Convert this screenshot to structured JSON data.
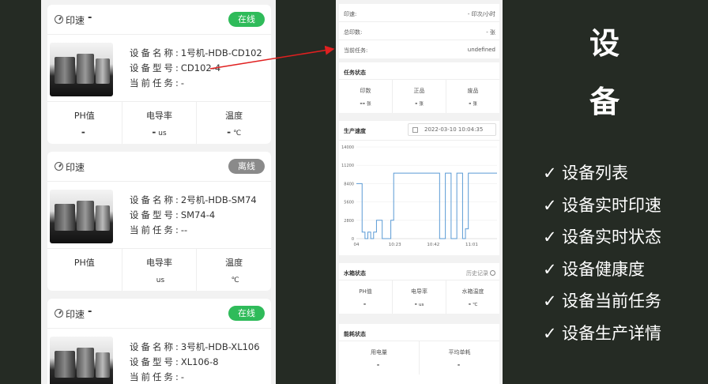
{
  "devices": [
    {
      "speed_label": "印速",
      "speed_value": "-",
      "status": "在线",
      "status_kind": "on",
      "name_key": "设备名称:",
      "name": "1号机-HDB-CD102",
      "model_key": "设备型号:",
      "model": "CD102-4",
      "task_key": "当前任务:",
      "task": "-",
      "metrics": [
        {
          "label": "PH值",
          "value": "-",
          "unit": ""
        },
        {
          "label": "电导率",
          "value": "-",
          "unit": "us"
        },
        {
          "label": "温度",
          "value": "-",
          "unit": "℃"
        }
      ]
    },
    {
      "speed_label": "印速",
      "speed_value": "",
      "status": "离线",
      "status_kind": "off",
      "name_key": "设备名称:",
      "name": "2号机-HDB-SM74",
      "model_key": "设备型号:",
      "model": "SM74-4",
      "task_key": "当前任务:",
      "task": "--",
      "metrics": [
        {
          "label": "PH值",
          "value": "",
          "unit": ""
        },
        {
          "label": "电导率",
          "value": "",
          "unit": "us"
        },
        {
          "label": "温度",
          "value": "",
          "unit": "℃"
        }
      ]
    },
    {
      "speed_label": "印速",
      "speed_value": "-",
      "status": "在线",
      "status_kind": "on",
      "name_key": "设备名称:",
      "name": "3号机-HDB-XL106",
      "model_key": "设备型号:",
      "model": "XL106-8",
      "task_key": "当前任务:",
      "task": "-"
    }
  ],
  "detail": {
    "rows": [
      {
        "label": "印速:",
        "value": "- 印次/小时"
      },
      {
        "label": "总印数:",
        "value": "- 张"
      },
      {
        "label": "当前任务:",
        "value": "undefined"
      }
    ],
    "task_status": {
      "title": "任务状态",
      "cols": [
        {
          "label": "印数",
          "value": "--",
          "unit": "张"
        },
        {
          "label": "正品",
          "value": "-",
          "unit": "张"
        },
        {
          "label": "废品",
          "value": "-",
          "unit": "张"
        }
      ]
    },
    "production": {
      "title": "生产速度",
      "date": "2022-03-10 10:04:35"
    },
    "water_tank": {
      "title": "水箱状态",
      "history": "历史记录",
      "cols": [
        {
          "label": "PH值",
          "value": "-",
          "unit": ""
        },
        {
          "label": "电导率",
          "value": "-",
          "unit": "us"
        },
        {
          "label": "水箱温度",
          "value": "-",
          "unit": "℃"
        }
      ]
    },
    "energy": {
      "title": "能耗状态",
      "cols": [
        {
          "label": "用电量",
          "value": "-",
          "unit": ""
        },
        {
          "label": "平均单耗",
          "value": "-",
          "unit": ""
        }
      ]
    }
  },
  "chart_data": {
    "type": "line",
    "title": "",
    "xlabel": "",
    "ylabel": "",
    "ylim": [
      0,
      14000
    ],
    "yticks": [
      0,
      2800,
      5600,
      8400,
      11200,
      14000
    ],
    "xticks": [
      "04",
      "10:23",
      "10:42",
      "11:01"
    ],
    "x": [
      0,
      1,
      2,
      3,
      4,
      5,
      6,
      7,
      8,
      9,
      10,
      11,
      12,
      13,
      14,
      15,
      16,
      17,
      18,
      19,
      20,
      21,
      22,
      23,
      24,
      25,
      26,
      27,
      28,
      29,
      30,
      31,
      32,
      33,
      34,
      35,
      36,
      37,
      38,
      39,
      40,
      41,
      42,
      43,
      44,
      45,
      46,
      47,
      48,
      49
    ],
    "values": [
      8400,
      8400,
      1000,
      0,
      1000,
      0,
      1000,
      2800,
      2800,
      0,
      0,
      0,
      2800,
      10000,
      10000,
      10000,
      10000,
      10000,
      10000,
      10000,
      10000,
      10000,
      10000,
      10000,
      10000,
      10000,
      10000,
      10000,
      10000,
      0,
      0,
      10000,
      10000,
      0,
      0,
      10000,
      10000,
      0,
      1500,
      10000,
      10000,
      10000,
      10000,
      10000,
      10000,
      10000,
      10000,
      10000,
      10000,
      10000
    ],
    "color": "#5b9bd5",
    "grid": true
  },
  "side": {
    "title_chars": [
      "设",
      "备"
    ],
    "check": "✓",
    "features": [
      "设备列表",
      "设备实时印速",
      "设备实时状态",
      "设备健康度",
      "设备当前任务",
      "设备生产详情"
    ]
  },
  "colors": {
    "online": "#2fbb5a",
    "offline": "#8a8a8a",
    "arrow": "#e02020",
    "background": "#252b24"
  }
}
